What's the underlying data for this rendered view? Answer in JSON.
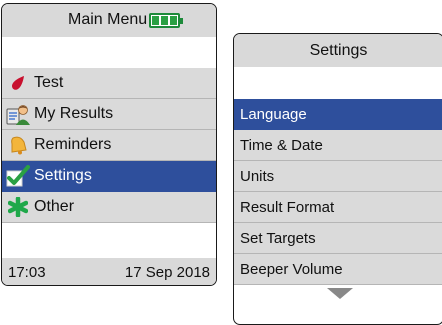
{
  "main_menu": {
    "title": "Main Menu",
    "battery_level": 1.0,
    "items": [
      {
        "label": "Test",
        "icon": "blood-drop-icon",
        "selected": false
      },
      {
        "label": "My Results",
        "icon": "results-person-icon",
        "selected": false
      },
      {
        "label": "Reminders",
        "icon": "bell-icon",
        "selected": false
      },
      {
        "label": "Settings",
        "icon": "checkmark-icon",
        "selected": true
      },
      {
        "label": "Other",
        "icon": "asterisk-icon",
        "selected": false
      }
    ],
    "time": "17:03",
    "date": "17 Sep 2018"
  },
  "settings": {
    "title": "Settings",
    "items": [
      {
        "label": "Language",
        "selected": true
      },
      {
        "label": "Time & Date",
        "selected": false
      },
      {
        "label": "Units",
        "selected": false
      },
      {
        "label": "Result Format",
        "selected": false
      },
      {
        "label": "Set Targets",
        "selected": false
      },
      {
        "label": "Beeper Volume",
        "selected": false
      }
    ],
    "scroll_icon": "triangle-down-icon"
  },
  "colors": {
    "selection": "#2e4f9c",
    "row": "#dadada",
    "battery": "#2aa043",
    "drop": "#c8102e",
    "check": "#2aa043",
    "asterisk": "#1fa84a"
  }
}
